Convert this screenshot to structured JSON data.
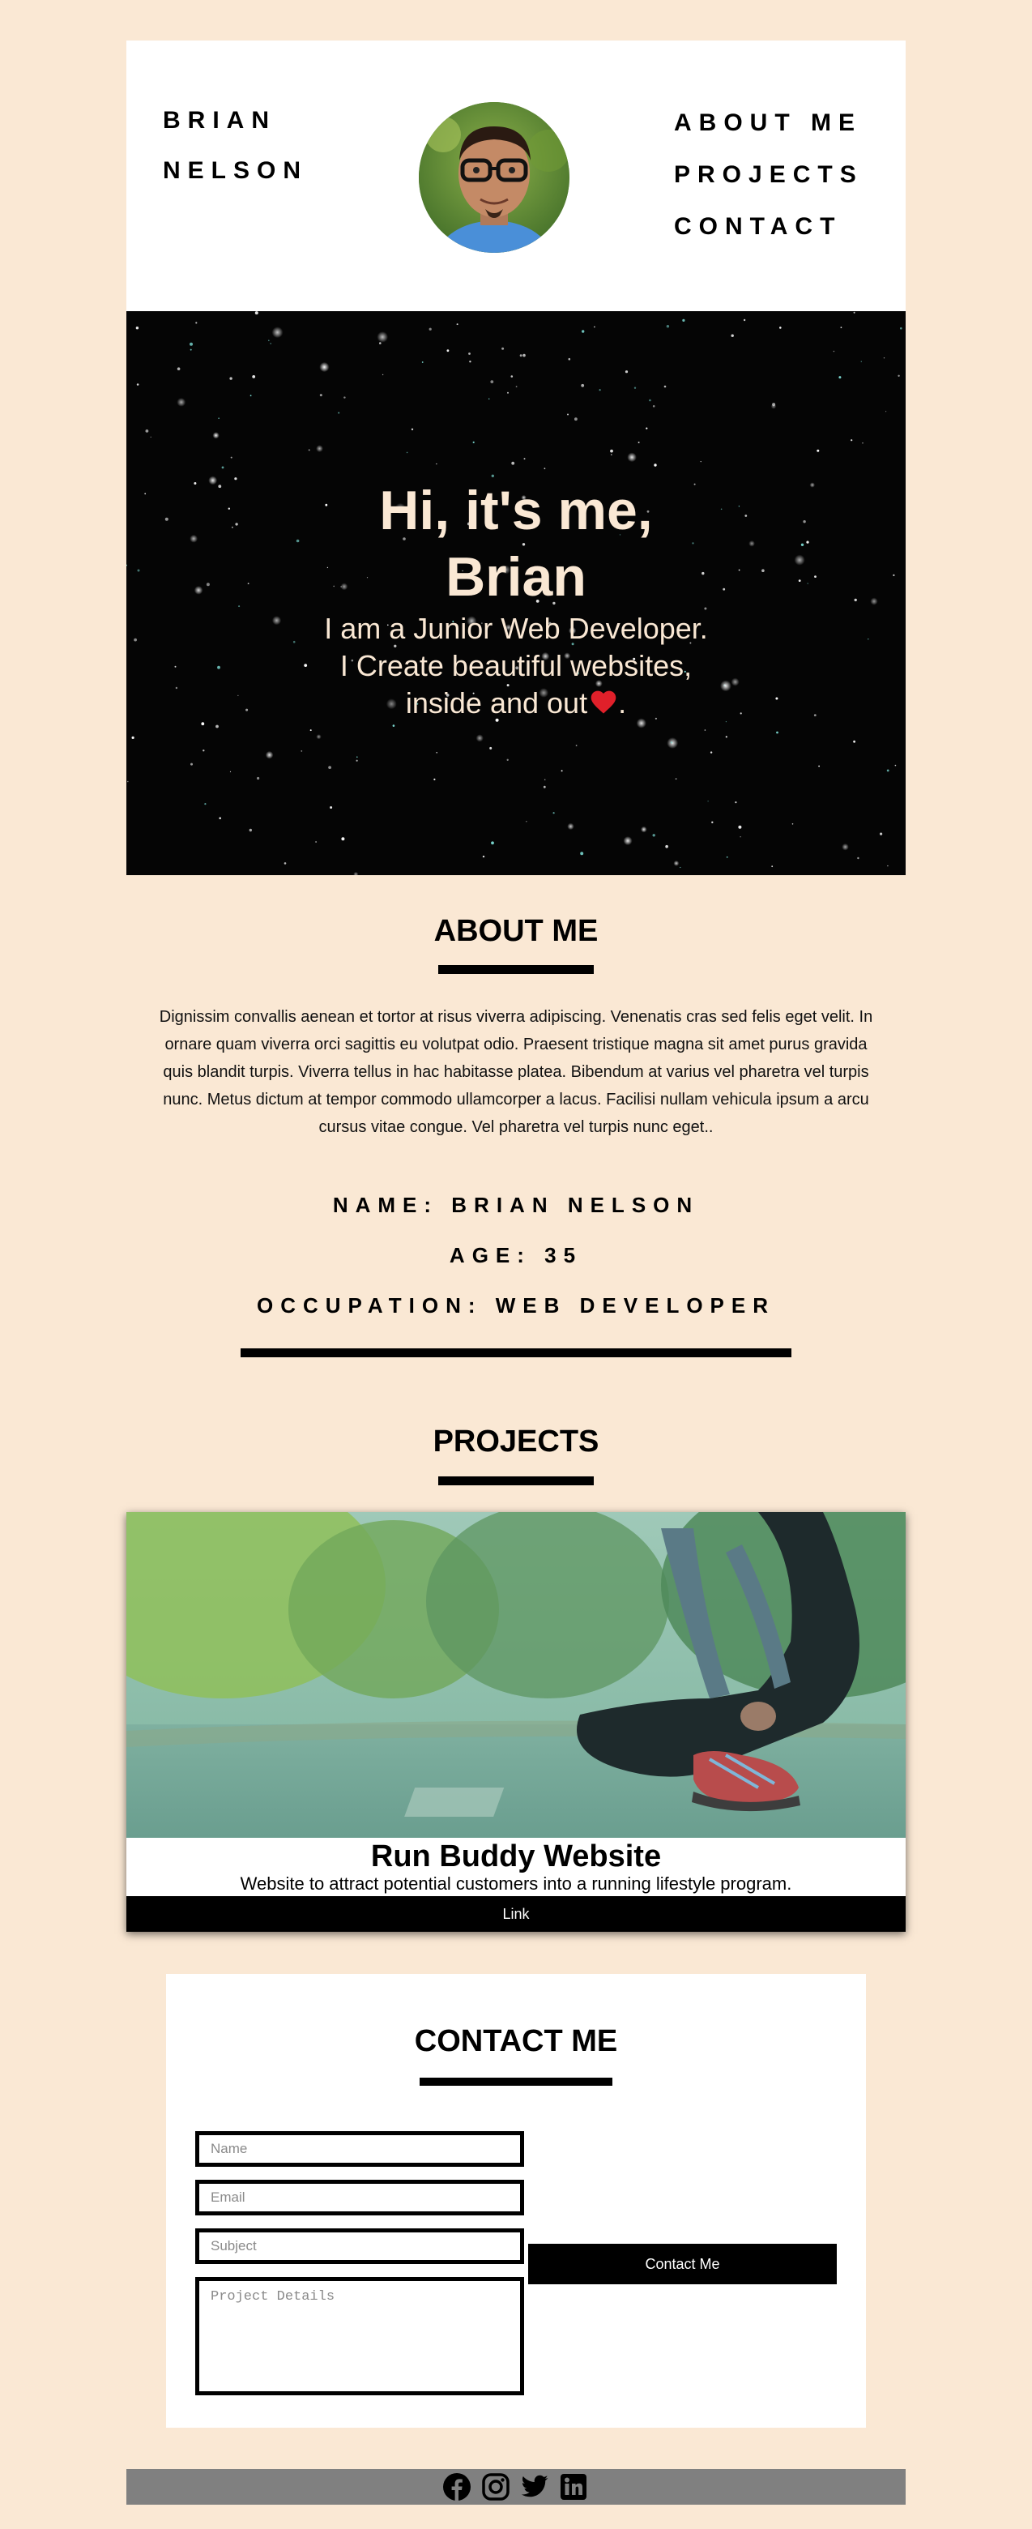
{
  "header": {
    "brand_first": "BRIAN",
    "brand_last": "NELSON",
    "nav": [
      "ABOUT ME",
      "PROJECTS",
      "CONTACT"
    ]
  },
  "hero": {
    "title_line1": "Hi, it's me,",
    "title_line2": "Brian",
    "sub_line1": "I am a Junior Web Developer.",
    "sub_line2": "I Create beautiful websites,",
    "sub_line3": "inside and out",
    "sub_end": ".",
    "heart_icon": "red-heart-icon"
  },
  "about": {
    "title": "ABOUT ME",
    "text": "Dignissim convallis aenean et tortor at risus viverra adipiscing. Venenatis cras sed felis eget velit. In ornare quam viverra orci sagittis eu volutpat odio. Praesent tristique magna sit amet purus gravida quis blandit turpis. Viverra tellus in hac habitasse platea. Bibendum at varius vel pharetra vel turpis nunc. Metus dictum at tempor commodo ullamcorper a lacus. Facilisi nullam vehicula ipsum a arcu cursus vitae congue. Vel pharetra vel turpis nunc eget..",
    "name": "NAME: BRIAN NELSON",
    "age": "AGE: 35",
    "occupation": "OCCUPATION: WEB DEVELOPER"
  },
  "projects": {
    "title": "PROJECTS",
    "items": [
      {
        "name": "Run Buddy Website",
        "description": "Website to attract potential customers into a running lifestyle program.",
        "link_label": "Link"
      }
    ]
  },
  "contact": {
    "title": "CONTACT ME",
    "name_placeholder": "Name",
    "email_placeholder": "Email",
    "subject_placeholder": "Subject",
    "details_placeholder": "Project Details",
    "button_label": "Contact Me"
  },
  "footer": {
    "icons": [
      "facebook-icon",
      "instagram-icon",
      "twitter-icon",
      "linkedin-icon"
    ]
  },
  "colors": {
    "background": "#fae8d4",
    "hero_text": "#fae8d4",
    "footer": "#808080",
    "accent": "#000000"
  }
}
